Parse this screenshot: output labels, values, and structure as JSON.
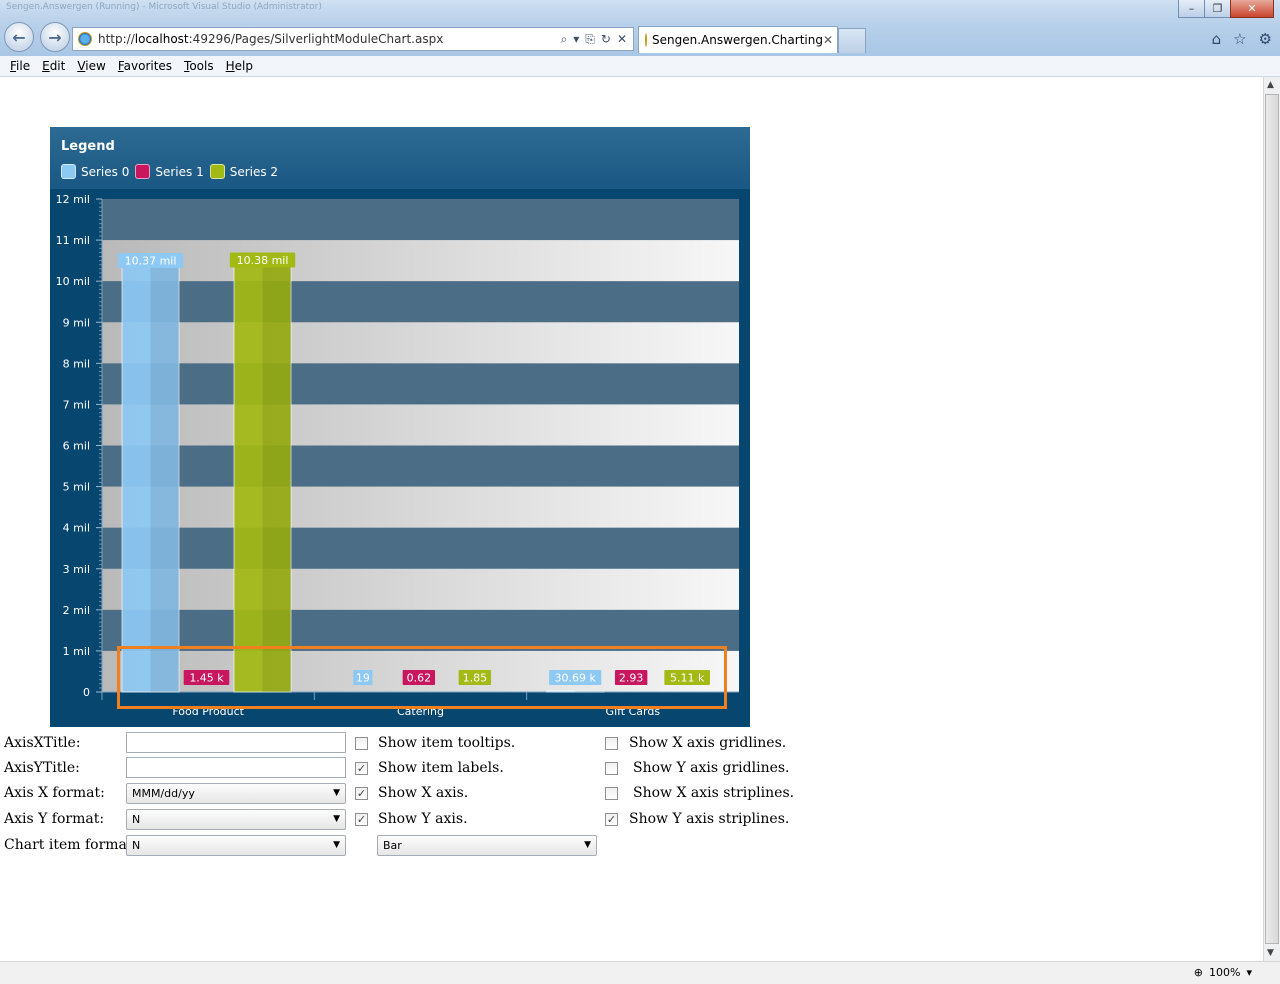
{
  "window": {
    "title": "Sengen.Answergen (Running) - Microsoft Visual Studio (Administrator)",
    "minimize_glyph": "–",
    "maximize_glyph": "❐",
    "close_glyph": "✕"
  },
  "browser": {
    "back_glyph": "←",
    "forward_glyph": "→",
    "url_prefix": "http://",
    "url_host": "localhost",
    "url_rest": ":49296/Pages/SilverlightModuleChart.aspx",
    "addr_tools": [
      "⌕",
      "▾",
      "⎘",
      "↻",
      "✕"
    ],
    "tab_label": "Sengen.Answergen.Charting",
    "tab_close": "✕",
    "home_icon": "⌂",
    "favorites_icon": "☆",
    "tools_icon": "⚙",
    "menu": [
      "File",
      "Edit",
      "View",
      "Favorites",
      "Tools",
      "Help"
    ],
    "zoom_icon": "⊕",
    "zoom": "100%",
    "zoom_arrow": "▾",
    "scroll_up": "▲",
    "scroll_down": "▼"
  },
  "legend": {
    "title": "Legend",
    "items": [
      {
        "label": "Series 0",
        "color": "#8ec9f4"
      },
      {
        "label": "Series 1",
        "color": "#c8165f"
      },
      {
        "label": "Series 2",
        "color": "#a3b914"
      }
    ]
  },
  "chart_data": {
    "type": "bar",
    "categories": [
      "Food Product",
      "Catering",
      "Gift Cards"
    ],
    "series": [
      {
        "name": "Series 0",
        "values": [
          10370000,
          19,
          30690
        ],
        "labels": [
          "10.37 mil",
          "19",
          "30.69 k"
        ],
        "color": "#8ec9f4"
      },
      {
        "name": "Series 1",
        "values": [
          1450,
          0.62,
          2930
        ],
        "labels": [
          "1.45 k",
          "0.62",
          "2.93"
        ],
        "color": "#c8165f"
      },
      {
        "name": "Series 2",
        "values": [
          10380000,
          1.85,
          5110
        ],
        "labels": [
          "10.38 mil",
          "1.85",
          "5.11 k"
        ],
        "color": "#a3b914"
      }
    ],
    "yticks": [
      "0",
      "1 mil",
      "2 mil",
      "3 mil",
      "4 mil",
      "5 mil",
      "6 mil",
      "7 mil",
      "8 mil",
      "9 mil",
      "10 mil",
      "11 mil",
      "12 mil"
    ],
    "ylim": [
      0,
      12000000
    ],
    "y_striplines": true,
    "gridlines": false,
    "legend_position": "top"
  },
  "form": {
    "axis_x_title_label": "AxisXTitle:",
    "axis_x_title_value": "",
    "axis_y_title_label": "AxisYTitle:",
    "axis_y_title_value": "",
    "axis_x_format_label": "Axis X format:",
    "axis_x_format_value": "MMM/dd/yy",
    "axis_y_format_label": "Axis Y format:",
    "axis_y_format_value": "N",
    "chart_item_format_label": "Chart item format:",
    "chart_item_format_value": "N",
    "chart_type_value": "Bar",
    "dropdown_arrow": "▼",
    "check_glyph": "✓",
    "checkboxes": [
      {
        "label": "Show item tooltips.",
        "checked": false
      },
      {
        "label": "Show item labels.",
        "checked": true
      },
      {
        "label": "Show X axis.",
        "checked": true
      },
      {
        "label": "Show Y axis.",
        "checked": true
      },
      {
        "label": "Show X axis gridlines.",
        "checked": false
      },
      {
        "label": "Show Y axis gridlines.",
        "checked": false
      },
      {
        "label": "Show X axis striplines.",
        "checked": false
      },
      {
        "label": "Show Y axis striplines.",
        "checked": true
      }
    ]
  }
}
